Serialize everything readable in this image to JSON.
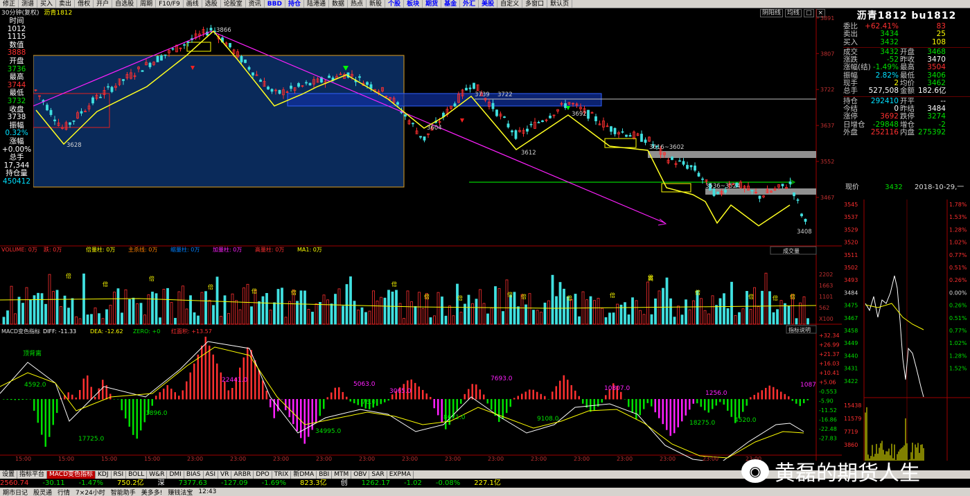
{
  "menu": {
    "items": [
      "修正",
      "测谱",
      "买入",
      "卖出",
      "借权",
      "开户",
      "自选股",
      "周期",
      "F10/F9",
      "画线",
      "选股",
      "论股室",
      "资讯",
      "BBD",
      "持仓",
      "陆港通",
      "数据",
      "热点",
      "新股",
      "个股",
      "板块",
      "期货",
      "基金",
      "外汇",
      "美股",
      "自定义",
      "多窗口",
      "默认页"
    ]
  },
  "chart": {
    "period": "30分钟(复权)",
    "symbol": "沥青1812",
    "top_buttons": [
      "阴阳线",
      "均线",
      "□",
      "×"
    ]
  },
  "left_panel": [
    {
      "t": "时间",
      "c": "#ffffff"
    },
    {
      "t": "1012",
      "c": "#ffffff"
    },
    {
      "t": "1115",
      "c": "#ffffff"
    },
    {
      "t": "数值",
      "c": "#ffffff"
    },
    {
      "t": "3888",
      "c": "#ff3030"
    },
    {
      "t": "开盘",
      "c": "#ffffff"
    },
    {
      "t": "3736",
      "c": "#00e000"
    },
    {
      "t": "最高",
      "c": "#ffffff"
    },
    {
      "t": "3744",
      "c": "#ff3030"
    },
    {
      "t": "最低",
      "c": "#ffffff"
    },
    {
      "t": "3732",
      "c": "#00e000"
    },
    {
      "t": "收盘",
      "c": "#ffffff"
    },
    {
      "t": "3738",
      "c": "#ffffff"
    },
    {
      "t": "振幅",
      "c": "#ffffff"
    },
    {
      "t": "0.32%",
      "c": "#00e0ff"
    },
    {
      "t": "涨幅",
      "c": "#ffffff"
    },
    {
      "t": "+0.00%",
      "c": "#ffffff"
    },
    {
      "t": "总手",
      "c": "#ffffff"
    },
    {
      "t": "17,344",
      "c": "#ffffff"
    },
    {
      "t": "持仓量",
      "c": "#ffffff"
    },
    {
      "t": "450412",
      "c": "#00e0ff"
    }
  ],
  "price_axis": [
    "3891",
    "3807",
    "3722",
    "3637",
    "3552",
    "3467"
  ],
  "annotations": {
    "p3866": "3866",
    "p3628": "3628",
    "p3739": "3739",
    "p3722": "3722",
    "p3604": "3604",
    "p3692": "3692",
    "p3612": "3612",
    "p3616": "3616~3602",
    "p3536": "3536~3524",
    "p3408": "3408"
  },
  "volume": {
    "header": [
      "VOLUME: 0万",
      "跌: 0万",
      "倍量柱: 0万",
      "主杀线: 0万",
      "缩量柱: 0万",
      "加量柱: 0万",
      "高量柱: 0万",
      "MA1: 0万"
    ],
    "axis": [
      "2202",
      "1663",
      "1101",
      "562",
      "X100"
    ],
    "button": "成交量",
    "tag1": "倍",
    "tag2": "高"
  },
  "macd": {
    "header": [
      "MACD变色指标",
      "DIFF: -11.33",
      "DEA: -12.62",
      "ZERO: +0",
      "红面积: +13.57"
    ],
    "button": "指标说明",
    "axis": [
      "+32.34",
      "+26.99",
      "+21.37",
      "+16.03",
      "+10.41",
      "+5.06",
      "-0.553",
      "-5.90",
      "-11.52",
      "-16.86",
      "-22.48",
      "-27.83"
    ],
    "labels": {
      "top_div": "顶背离",
      "a1": "4592.0",
      "a2": "17725.0",
      "a3": "1896.0",
      "a4": "22441.0",
      "a5": "34995.0",
      "a6": "5063.0",
      "a7": "76.0",
      "a8": "3065.0",
      "a9": "8671.0",
      "a10": "7693.0",
      "a11": "9108.0",
      "a12": "10807.0",
      "a13": "18275.0",
      "a14": "1256.0",
      "a15": "4520.0",
      "a16": "1087"
    }
  },
  "time_axis": [
    "15:00",
    "15:00",
    "15:00",
    "15:00",
    "23:00",
    "23:00",
    "23:00",
    "23:00",
    "23:00",
    "23:00",
    "23:00",
    "23:00",
    "23:00",
    "23:00",
    "23:00",
    "23:00",
    "23:00",
    "23:00"
  ],
  "quote": {
    "title": "沥青1812 bu1812",
    "rows1": [
      {
        "k": "委比",
        "v": "+62.41%",
        "vc": "#ff3030",
        "k2": "",
        "v2": "83",
        "v2c": "#ff3030"
      },
      {
        "k": "卖出",
        "v": "3434",
        "vc": "#00e000",
        "k2": "",
        "v2": "25",
        "v2c": "#ffff00"
      },
      {
        "k": "买入",
        "v": "3432",
        "vc": "#00e000",
        "k2": "",
        "v2": "108",
        "v2c": "#ffff00"
      }
    ],
    "rows2": [
      {
        "k": "成交",
        "v": "3432",
        "vc": "#00e000",
        "k2": "开盘",
        "v2": "3468",
        "v2c": "#00e000"
      },
      {
        "k": "涨跌",
        "v": "-52",
        "vc": "#00e000",
        "k2": "昨收",
        "v2": "3470",
        "v2c": "#ffffff"
      },
      {
        "k": "涨幅(结)",
        "v": "-1.49%",
        "vc": "#00e000",
        "k2": "最高",
        "v2": "3504",
        "v2c": "#ff3030"
      },
      {
        "k": "振幅",
        "v": "2.82%",
        "vc": "#00e0ff",
        "k2": "最低",
        "v2": "3406",
        "v2c": "#00e000"
      },
      {
        "k": "现手",
        "v": "2",
        "vc": "#ffff00",
        "k2": "均价",
        "v2": "3462",
        "v2c": "#00e000"
      },
      {
        "k": "总手",
        "v": "527,508",
        "vc": "#ffffff",
        "k2": "金额",
        "v2": "182.6亿",
        "v2c": "#ffffff"
      }
    ],
    "rows3": [
      {
        "k": "持仓",
        "v": "292410",
        "vc": "#00e0ff",
        "k2": "开平",
        "v2": "--",
        "v2c": "#ffffff"
      },
      {
        "k": "今结",
        "v": "0",
        "vc": "#ffffff",
        "k2": "昨结",
        "v2": "3484",
        "v2c": "#ffffff"
      },
      {
        "k": "涨停",
        "v": "3692",
        "vc": "#ff3030",
        "k2": "跌停",
        "v2": "3274",
        "v2c": "#00e000"
      },
      {
        "k": "日增仓",
        "v": "-29848",
        "vc": "#00e000",
        "k2": "增仓",
        "v2": "-2",
        "v2c": "#00e000"
      },
      {
        "k": "外盘",
        "v": "252116",
        "vc": "#ff3030",
        "k2": "内盘",
        "v2": "275392",
        "v2c": "#00e000"
      }
    ],
    "now_label": "现价",
    "now_value": "3432",
    "now_date": "2018-10-29,一",
    "mini_left": [
      "3545",
      "3537",
      "3529",
      "3520",
      "3511",
      "3502",
      "3493",
      "3484",
      "3475",
      "3467",
      "3458",
      "3449",
      "3440",
      "3431",
      "3422",
      "15438",
      "11579",
      "7719",
      "3860"
    ],
    "mini_right": [
      "1.78%",
      "1.53%",
      "1.28%",
      "1.02%",
      "0.77%",
      "0.51%",
      "0.26%",
      "0.00%",
      "0.26%",
      "0.51%",
      "0.77%",
      "1.02%",
      "1.28%",
      "1.52%"
    ]
  },
  "bottom_tabs": [
    "设置",
    "指标平台",
    "MACD变色指标",
    "KDJ",
    "RSI",
    "BOLL",
    "W&R",
    "DMI",
    "BIAS",
    "ASI",
    "VR",
    "ARBR",
    "DPO",
    "TRIX",
    "新DMA",
    "BBI",
    "MTM",
    "OBV",
    "SAR",
    "EXPMA"
  ],
  "index_bar": [
    {
      "t": "2560.74",
      "c": "#ff3030"
    },
    {
      "t": "-30.11",
      "c": "#00e000"
    },
    {
      "t": "-1.47%",
      "c": "#00e000"
    },
    {
      "t": "750.2亿",
      "c": "#ffff00"
    },
    {
      "t": "深",
      "c": "#ffffff"
    },
    {
      "t": "7377.63",
      "c": "#00e000"
    },
    {
      "t": "-127.09",
      "c": "#00e000"
    },
    {
      "t": "-1.69%",
      "c": "#00e000"
    },
    {
      "t": "823.3亿",
      "c": "#ffff00"
    },
    {
      "t": "创",
      "c": "#ffffff"
    },
    {
      "t": "1262.17",
      "c": "#00e000"
    },
    {
      "t": "-1.02",
      "c": "#00e000"
    },
    {
      "t": "-0.08%",
      "c": "#00e000"
    },
    {
      "t": "227.1亿",
      "c": "#ffff00"
    }
  ],
  "status_bar": [
    "期市日记",
    "股灵通",
    "行情",
    "7×24小时",
    "智能助手",
    "美多多!",
    "赚钱法宝",
    "12:43"
  ],
  "watermark": "黄磊的期货人生"
}
